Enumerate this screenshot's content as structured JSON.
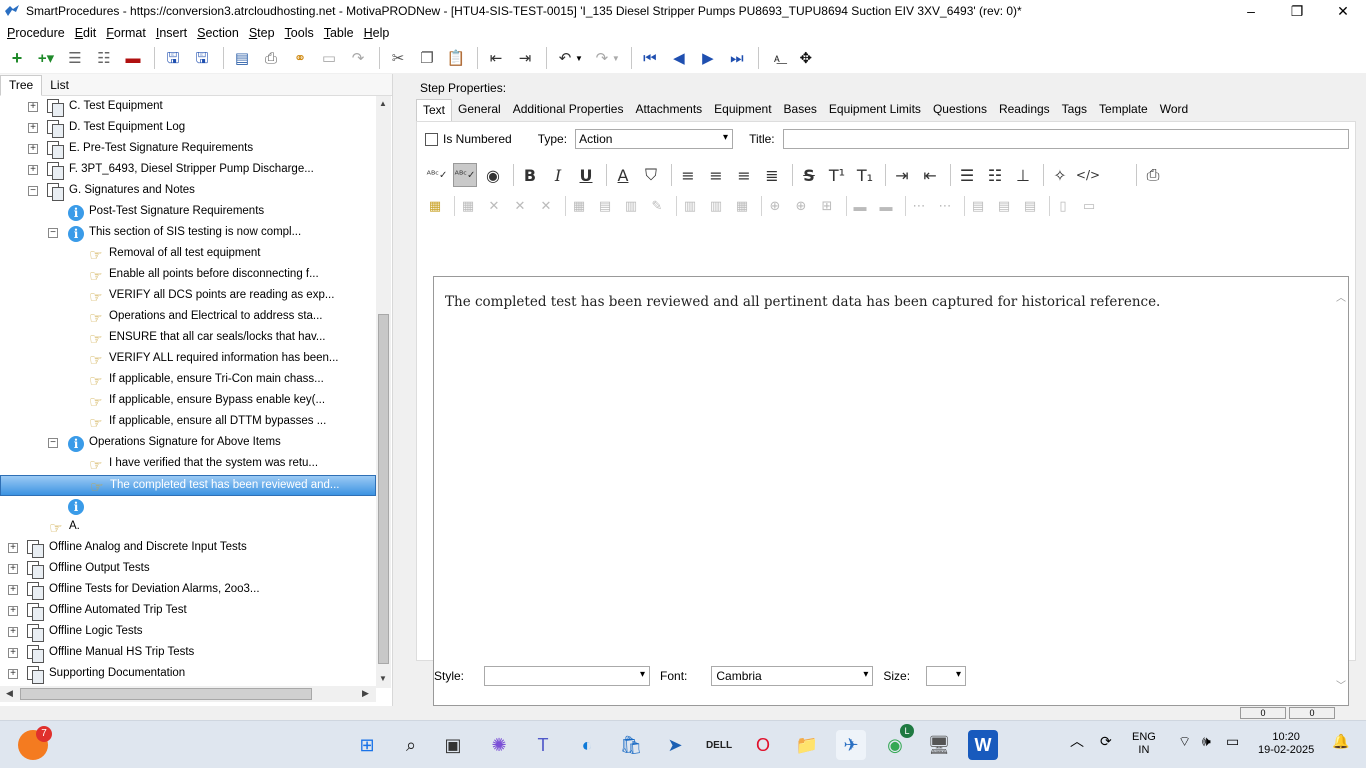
{
  "window": {
    "title": "SmartProcedures - https://conversion3.atrcloudhosting.net - MotivaPRODNew - [HTU4-SIS-TEST-0015] 'I_135 Diesel Stripper Pumps PU8693_TUPU8694 Suction EIV 3XV_6493' (rev: 0)*",
    "minimize": "–",
    "restore": "❐",
    "close": "✕"
  },
  "menu": {
    "procedure": "Procedure",
    "edit": "Edit",
    "format": "Format",
    "insert": "Insert",
    "section": "Section",
    "step": "Step",
    "tools": "Tools",
    "table": "Table",
    "help": "Help"
  },
  "left_panel": {
    "tabs": [
      "Tree",
      "List"
    ],
    "tree": [
      {
        "label": "C. Test Equipment",
        "icon": "document-icon",
        "level": 2,
        "expander": "+"
      },
      {
        "label": "D. Test Equipment Log",
        "icon": "document-icon",
        "level": 2,
        "expander": "+"
      },
      {
        "label": "E. Pre-Test Signature Requirements",
        "icon": "document-icon",
        "level": 2,
        "expander": "+"
      },
      {
        "label": "F. 3PT_6493, Diesel Stripper Pump Discharge...",
        "icon": "document-icon",
        "level": 2,
        "expander": "+"
      },
      {
        "label": "G. Signatures and Notes",
        "icon": "document-icon",
        "level": 2,
        "expander": "−"
      },
      {
        "label": "Post-Test Signature Requirements",
        "icon": "info-icon",
        "level": 3,
        "expander": ""
      },
      {
        "label": "This section of SIS testing is now compl...",
        "icon": "info-icon",
        "level": 3,
        "expander": "−"
      },
      {
        "label": "Removal of all test equipment",
        "icon": "step-hand-icon",
        "level": 4,
        "expander": ""
      },
      {
        "label": "Enable all points before disconnecting f...",
        "icon": "step-hand-icon",
        "level": 4,
        "expander": ""
      },
      {
        "label": "VERIFY all DCS points are reading as exp...",
        "icon": "step-hand-icon",
        "level": 4,
        "expander": ""
      },
      {
        "label": "Operations and Electrical to address sta...",
        "icon": "step-hand-icon",
        "level": 4,
        "expander": ""
      },
      {
        "label": "ENSURE that all car seals/locks that hav...",
        "icon": "step-hand-icon",
        "level": 4,
        "expander": ""
      },
      {
        "label": "VERIFY ALL required information has been...",
        "icon": "step-hand-icon",
        "level": 4,
        "expander": ""
      },
      {
        "label": "If applicable, ensure Tri-Con main chass...",
        "icon": "step-hand-icon",
        "level": 4,
        "expander": ""
      },
      {
        "label": "If applicable, ensure Bypass enable key(...",
        "icon": "step-hand-icon",
        "level": 4,
        "expander": ""
      },
      {
        "label": "If applicable, ensure all DTTM bypasses ...",
        "icon": "step-hand-icon",
        "level": 4,
        "expander": ""
      },
      {
        "label": "Operations Signature for Above Items",
        "icon": "info-icon",
        "level": 3,
        "expander": "−"
      },
      {
        "label": "I have verified that the system was retu...",
        "icon": "step-hand-icon",
        "level": 4,
        "expander": ""
      },
      {
        "label": "The completed test has been reviewed and...",
        "icon": "step-hand-icon",
        "level": 4,
        "expander": "",
        "selected": true
      },
      {
        "label": "",
        "icon": "info-icon",
        "level": 3,
        "expander": ""
      },
      {
        "label": "A.",
        "icon": "step-hand-icon",
        "level": 2,
        "expander": ""
      },
      {
        "label": "Offline Analog and Discrete Input Tests",
        "icon": "document-icon",
        "level": 1,
        "expander": "+"
      },
      {
        "label": "Offline Output Tests",
        "icon": "document-icon",
        "level": 1,
        "expander": "+"
      },
      {
        "label": "Offline Tests for Deviation Alarms, 2oo3...",
        "icon": "document-icon",
        "level": 1,
        "expander": "+"
      },
      {
        "label": "Offline Automated Trip Test",
        "icon": "document-icon",
        "level": 1,
        "expander": "+"
      },
      {
        "label": "Offline Logic Tests",
        "icon": "document-icon",
        "level": 1,
        "expander": "+"
      },
      {
        "label": "Offline Manual HS Trip Tests",
        "icon": "document-icon",
        "level": 1,
        "expander": "+"
      },
      {
        "label": "Supporting Documentation",
        "icon": "document-icon",
        "level": 1,
        "expander": "+"
      }
    ]
  },
  "step_properties": {
    "heading": "Step Properties:",
    "tabs": [
      "Text",
      "General",
      "Additional Properties",
      "Attachments",
      "Equipment",
      "Bases",
      "Equipment Limits",
      "Questions",
      "Readings",
      "Tags",
      "Template",
      "Word"
    ],
    "is_numbered_label": "Is Numbered",
    "type_label": "Type:",
    "type_value": "Action",
    "title_label": "Title:",
    "title_value": "",
    "editor_text": "The completed test has been reviewed and all pertinent data has been captured for historical reference.",
    "style_label": "Style:",
    "style_value": "",
    "font_label": "Font:",
    "font_value": "Cambria",
    "size_label": "Size:",
    "size_value": ""
  },
  "statusbar": {
    "cells": [
      "0",
      "0"
    ]
  },
  "taskbar": {
    "notification_count": "7",
    "chrome_badge": "L",
    "lang_line1": "ENG",
    "lang_line2": "IN",
    "time": "10:20",
    "date": "19-02-2025"
  },
  "colors": {
    "selection": "#3c93e2",
    "info_icon": "#3a9be8",
    "toolbar_blue": "#1f4fb0"
  }
}
